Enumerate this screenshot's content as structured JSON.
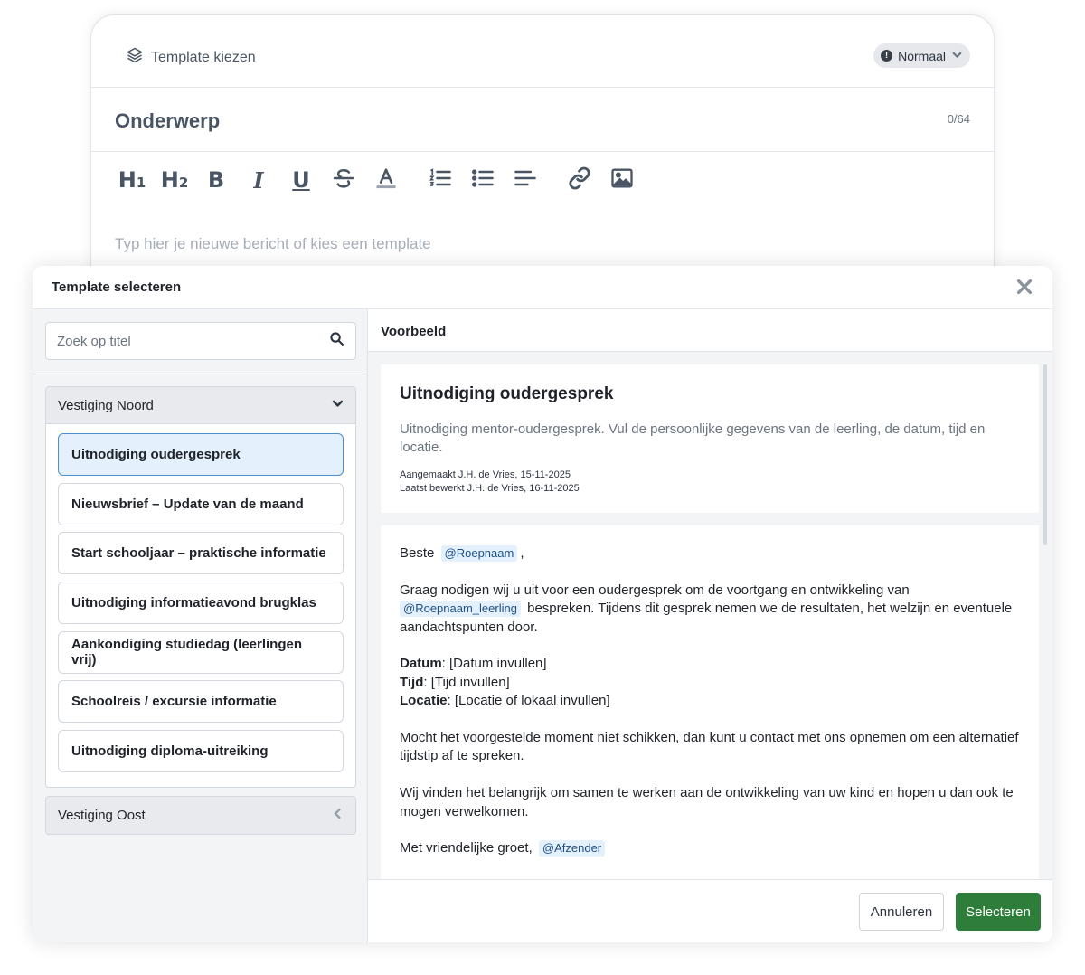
{
  "editor": {
    "template_choose_label": "Template kiezen",
    "priority_label": "Normaal",
    "subject_placeholder": "Onderwerp",
    "subject_counter": "0/64",
    "toolbar": {
      "h1_label": "H1",
      "h2_label": "H2",
      "bold_label": "B",
      "italic_label": "I",
      "underline_label": "U"
    },
    "body_placeholder": "Typ hier je nieuwe bericht of kies een template"
  },
  "modal": {
    "title": "Template selecteren",
    "search_placeholder": "Zoek op titel",
    "groups": [
      {
        "name": "Vestiging Noord",
        "expanded": true,
        "items": [
          "Uitnodiging oudergesprek",
          "Nieuwsbrief – Update van de maand",
          "Start schooljaar – praktische informatie",
          "Uitnodiging informatieavond brugklas",
          "Aankondiging studiedag (leerlingen vrij)",
          "Schoolreis / excursie informatie",
          "Uitnodiging diploma-uitreiking"
        ],
        "selected_item": "Uitnodiging oudergesprek"
      },
      {
        "name": "Vestiging Oost",
        "expanded": false
      }
    ],
    "preview": {
      "header": "Voorbeeld",
      "title": "Uitnodiging oudergesprek",
      "description": "Uitnodiging mentor-oudergesprek. Vul de persoonlijke gegevens van de leerling, de datum, tijd en locatie.",
      "created": "Aangemaakt J.H. de Vries, 15-11-2025",
      "edited": "Laatst bewerkt J.H. de Vries, 16-11-2025",
      "body": {
        "greeting": "Beste",
        "greeting_tag": "@Roepnaam",
        "greeting_end": ",",
        "para1_start": "Graag nodigen wij u uit voor een oudergesprek om de voortgang en ontwikkeling van",
        "para1_tag": "@Roepnaam_leerling",
        "para1_end": "bespreken. Tijdens dit gesprek nemen we de resultaten, het welzijn en eventuele aandachtspunten door.",
        "date_label": "Datum",
        "date_value": ": [Datum invullen]",
        "time_label": "Tijd",
        "time_value": ": [Tijd invullen]",
        "location_label": "Locatie",
        "location_value": ": [Locatie of lokaal invullen]",
        "para3": "Mocht het voorgestelde moment niet schikken, dan kunt u contact met ons opnemen om een alternatief tijdstip af te spreken.",
        "para4": "Wij vinden het belangrijk om samen te werken aan de ontwikkeling van uw kind en hopen u dan ook te mogen verwelkomen.",
        "closing": "Met vriendelijke groet,",
        "closing_tag": "@Afzender"
      }
    },
    "cancel_label": "Annuleren",
    "select_label": "Selecteren"
  },
  "colors": {
    "accent_green": "#2e7d3a",
    "selected_blue_bg": "#e4f1fc",
    "selected_blue_border": "#4a8fd0",
    "tag_text": "#1d4f84"
  }
}
